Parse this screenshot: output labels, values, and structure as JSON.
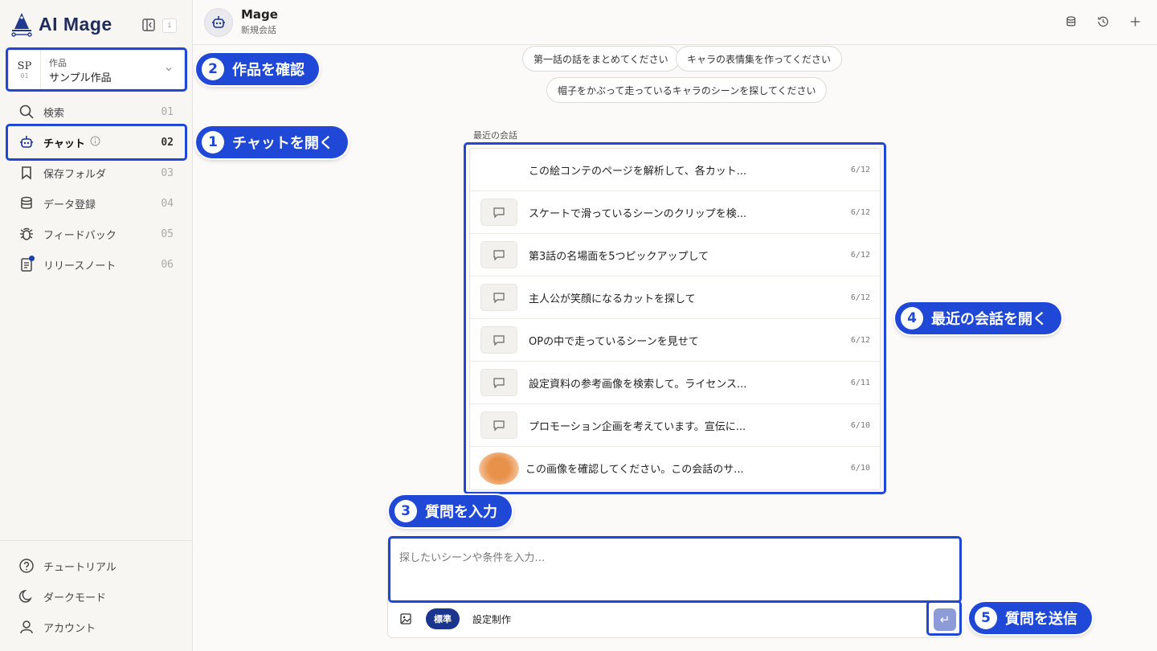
{
  "app": {
    "name": "AI Mage",
    "kbd_hint": "i"
  },
  "work": {
    "code": "SP",
    "code_sub": "01",
    "label": "作品",
    "value": "サンプル作品"
  },
  "nav": [
    {
      "label": "検索",
      "num": "01",
      "icon": "search-icon"
    },
    {
      "label": "チャット",
      "num": "02",
      "icon": "robot-icon"
    },
    {
      "label": "保存フォルダ",
      "num": "03",
      "icon": "bookmark-icon"
    },
    {
      "label": "データ登録",
      "num": "04",
      "icon": "database-icon"
    },
    {
      "label": "フィードバック",
      "num": "05",
      "icon": "bug-icon"
    },
    {
      "label": "リリースノート",
      "num": "06",
      "icon": "document-icon"
    }
  ],
  "bottom_nav": [
    {
      "label": "チュートリアル",
      "icon": "help-circle-icon"
    },
    {
      "label": "ダークモード",
      "icon": "moon-icon"
    },
    {
      "label": "アカウント",
      "icon": "user-icon"
    }
  ],
  "header": {
    "title": "Mage",
    "subtitle": "新規会話"
  },
  "suggestions": [
    "第一話の話をまとめてください",
    "キャラの表情集を作ってください",
    "帽子をかぶって走っているキャラのシーンを探してください"
  ],
  "recent": {
    "label": "最近の会話",
    "items": [
      {
        "text": "この絵コンテのページを解析して、各カット...",
        "date": "6/12"
      },
      {
        "text": "スケートで滑っているシーンのクリップを検...",
        "date": "6/12"
      },
      {
        "text": "第3話の名場面を5つピックアップして",
        "date": "6/12"
      },
      {
        "text": "主人公が笑顔になるカットを探して",
        "date": "6/12"
      },
      {
        "text": "OPの中で走っているシーンを見せて",
        "date": "6/12"
      },
      {
        "text": "設定資料の参考画像を検索して。ライセンス...",
        "date": "6/11"
      },
      {
        "text": "プロモーション企画を考えています。宣伝に...",
        "date": "6/10"
      },
      {
        "text": "この画像を確認してください。この会話のサ...",
        "date": "6/10"
      }
    ]
  },
  "input": {
    "placeholder": "探したいシーンや条件を入力…",
    "mode_active": "標準",
    "mode_other": "設定制作",
    "send_symbol": "↵"
  },
  "callouts": [
    {
      "num": "1",
      "text": "チャットを開く"
    },
    {
      "num": "2",
      "text": "作品を確認"
    },
    {
      "num": "3",
      "text": "質問を入力"
    },
    {
      "num": "4",
      "text": "最近の会話を開く"
    },
    {
      "num": "5",
      "text": "質問を送信"
    }
  ],
  "colors": {
    "accent": "#1f48d6",
    "brand": "#1f2c5c",
    "mode_pill": "#1a3490"
  }
}
